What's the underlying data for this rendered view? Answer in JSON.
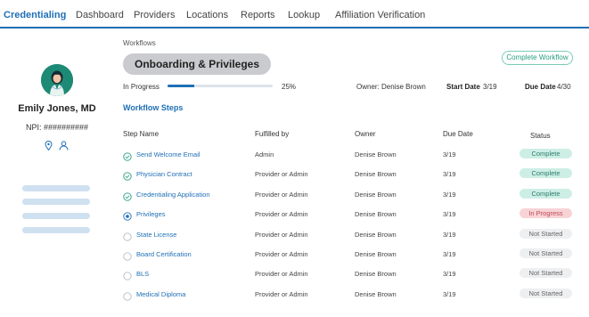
{
  "nav": {
    "items": [
      "Credentialing",
      "Dashboard",
      "Providers",
      "Locations",
      "Reports",
      "Lookup",
      "Affiliation Verification"
    ],
    "active": "Credentialing"
  },
  "profile": {
    "name": "Emily Jones, MD",
    "npi": "NPI: ##########",
    "avatar_color": "#1d8a75"
  },
  "workflow": {
    "breadcrumb": "Workflows",
    "title": "Onboarding & Privileges",
    "complete_button": "Complete Workflow",
    "status": "In Progress",
    "progress": 0.25,
    "progress_text": "25%",
    "owner": "Owner: Denise Brown",
    "start_label": "Start Date",
    "start_value": "3/19",
    "due_label": "Due Date",
    "due_value": "4/30"
  },
  "steps": {
    "title": "Workflow Steps",
    "headers": {
      "name": "Step Name",
      "fulfilled": "Fulfilled by",
      "owner": "Owner",
      "due": "Due Date",
      "status": "Status"
    },
    "rows": [
      {
        "name": "Send Welcome Email",
        "fulfilled": "Admin",
        "owner": "Denise Brown",
        "due": "3/19",
        "status": "Complete",
        "state": "complete"
      },
      {
        "name": "Physician Contract",
        "fulfilled": "Provider or Admin",
        "owner": "Denise Brown",
        "due": "3/19",
        "status": "Complete",
        "state": "complete"
      },
      {
        "name": "Credentialing Application",
        "fulfilled": "Provider or Admin",
        "owner": "Denise Brown",
        "due": "3/19",
        "status": "Complete",
        "state": "complete"
      },
      {
        "name": "Privileges",
        "fulfilled": "Provider or Admin",
        "owner": "Denise Brown",
        "due": "3/19",
        "status": "In Progress",
        "state": "inprogress"
      },
      {
        "name": "State License",
        "fulfilled": "Provider or Admin",
        "owner": "Denise Brown",
        "due": "3/19",
        "status": "Not Started",
        "state": "notstarted"
      },
      {
        "name": "Board Certification",
        "fulfilled": "Provider or Admin",
        "owner": "Denise Brown",
        "due": "3/19",
        "status": "Not Started",
        "state": "notstarted"
      },
      {
        "name": "BLS",
        "fulfilled": "Provider or Admin",
        "owner": "Denise Brown",
        "due": "3/19",
        "status": "Not Started",
        "state": "notstarted"
      },
      {
        "name": "Medical Diploma",
        "fulfilled": "Provider or Admin",
        "owner": "Denise Brown",
        "due": "3/19",
        "status": "Not Started",
        "state": "notstarted"
      }
    ]
  },
  "colors": {
    "accent": "#1f6fb5",
    "complete": "#cdeee5",
    "in_progress": "#f7d3d6",
    "not_started": "#eeeff1"
  }
}
